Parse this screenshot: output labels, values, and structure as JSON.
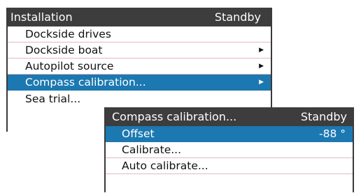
{
  "installation_menu": {
    "title": "Installation",
    "status": "Standby",
    "items": [
      {
        "label": "Dockside drives",
        "arrow": ""
      },
      {
        "label": "Dockside boat",
        "arrow": "▶"
      },
      {
        "label": "Autopilot source",
        "arrow": "▶"
      },
      {
        "label": "Compass calibration...",
        "arrow": "▶"
      },
      {
        "label": "Sea trial...",
        "arrow": ""
      }
    ],
    "selected_index": 3
  },
  "compass_menu": {
    "title": "Compass calibration...",
    "status": "Standby",
    "items": [
      {
        "label": "Offset",
        "value": "-88 °"
      },
      {
        "label": "Calibrate...",
        "value": ""
      },
      {
        "label": "Auto calibrate...",
        "value": ""
      }
    ],
    "selected_index": 0
  },
  "colors": {
    "titlebar": "#3d3d3d",
    "selection": "#1c78b0",
    "divider": "#e2b8c2"
  },
  "icons": {
    "submenu_arrow": "right-triangle-icon"
  }
}
